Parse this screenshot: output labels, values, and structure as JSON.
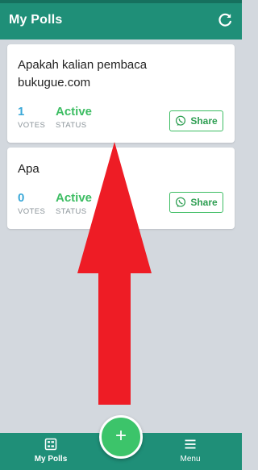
{
  "header": {
    "title": "My Polls",
    "refresh_icon": "refresh-icon"
  },
  "polls": [
    {
      "question": "Apakah kalian pembaca bukugue.com",
      "votes": "1",
      "votes_label": "VOTES",
      "status": "Active",
      "status_label": "STATUS",
      "share_label": "Share"
    },
    {
      "question": "Apa",
      "votes": "0",
      "votes_label": "VOTES",
      "status": "Active",
      "status_label": "STATUS",
      "share_label": "Share"
    }
  ],
  "fab": {
    "label": "+"
  },
  "bottom_nav": [
    {
      "label": "My Polls",
      "icon": "polls-icon"
    },
    {
      "label": "Menu",
      "icon": "hamburger-icon"
    }
  ],
  "colors": {
    "primary": "#1f8f78",
    "accent": "#3cc46a",
    "votes": "#3aa8d8",
    "status": "#3dbd63",
    "annotation_arrow": "#ee1c25"
  }
}
